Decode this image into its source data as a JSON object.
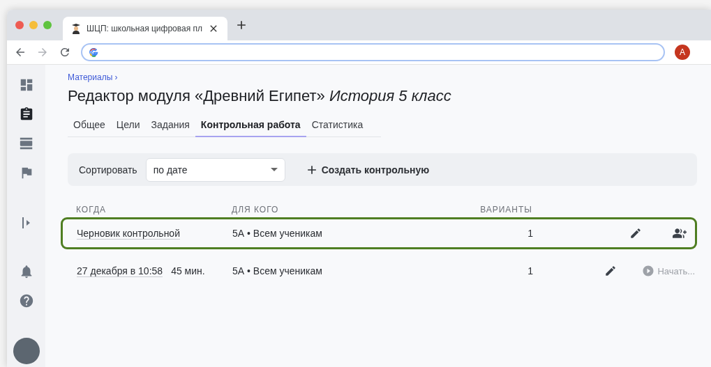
{
  "browser": {
    "tab_title": "ШЦП: школьная цифровая пл",
    "profile_initial": "A"
  },
  "sidebar": {
    "items": [
      {
        "kind": "dashboard",
        "selected": false
      },
      {
        "kind": "clipboard",
        "selected": true
      },
      {
        "kind": "table",
        "selected": false
      },
      {
        "kind": "flag",
        "selected": false
      },
      {
        "kind": "expand",
        "selected": false
      }
    ],
    "bottom_items": [
      {
        "kind": "bell"
      },
      {
        "kind": "help"
      },
      {
        "kind": "avatar"
      }
    ]
  },
  "breadcrumb": "Материалы",
  "breadcrumb_separator": "›",
  "title": {
    "main": "Редактор модуля «Древний Египет»",
    "subtitle": "История 5 класс"
  },
  "tabs": [
    {
      "label": "Общее",
      "selected": false
    },
    {
      "label": "Цели",
      "selected": false
    },
    {
      "label": "Задания",
      "selected": false
    },
    {
      "label": "Контрольная работа",
      "selected": true
    },
    {
      "label": "Статистика",
      "selected": false
    }
  ],
  "toolbar": {
    "sort_label": "Сортировать",
    "sort_value": "по дате",
    "create_button": "Создать контрольную"
  },
  "table": {
    "columns": [
      "КОГДА",
      "ДЛЯ КОГО",
      "ВАРИАНТЫ"
    ],
    "rows": [
      {
        "kind": "draft",
        "selected": true,
        "when": "Черновик контрольной",
        "who": "5А • Всем ученикам",
        "variants": "1"
      },
      {
        "kind": "scheduled",
        "selected": false,
        "when": "27 декабря в 10:58",
        "duration": "45 мин.",
        "who": "5А • Всем ученикам",
        "variants": "1",
        "start_label": "Начать..."
      }
    ]
  }
}
